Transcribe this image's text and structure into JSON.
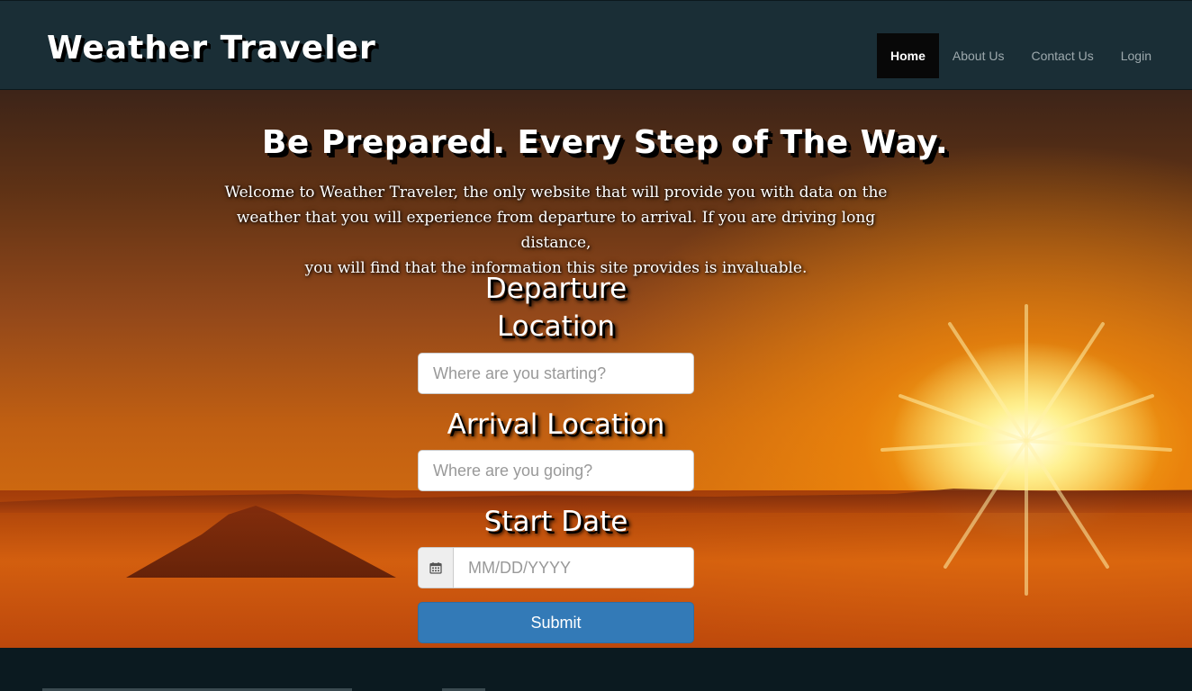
{
  "navbar": {
    "brand": "Weather Traveler",
    "items": [
      {
        "label": "Home",
        "active": true
      },
      {
        "label": "About Us",
        "active": false
      },
      {
        "label": "Contact Us",
        "active": false
      },
      {
        "label": "Login",
        "active": false
      }
    ]
  },
  "hero": {
    "headline": "Be Prepared. Every Step of The Way.",
    "intro_lines": [
      "Welcome to Weather Traveler, the only website that will provide you with data on the",
      "weather that you will experience from departure to arrival. If you are driving long distance,",
      "you will find that the information this site provides is invaluable."
    ]
  },
  "form": {
    "departure": {
      "label_line1": "Departure",
      "label_line2": "Location",
      "placeholder": "Where are you starting?",
      "value": ""
    },
    "arrival": {
      "label": "Arrival Location",
      "placeholder": "Where are you going?",
      "value": ""
    },
    "start_date": {
      "label": "Start Date",
      "placeholder": "MM/DD/YYYY",
      "value": "",
      "icon": "calendar-icon"
    },
    "submit_label": "Submit"
  },
  "colors": {
    "navbar_bg": "#1a2e36",
    "nav_active_bg": "#080808",
    "submit_bg": "#337ab7",
    "footer_bg": "#0b1a20"
  }
}
